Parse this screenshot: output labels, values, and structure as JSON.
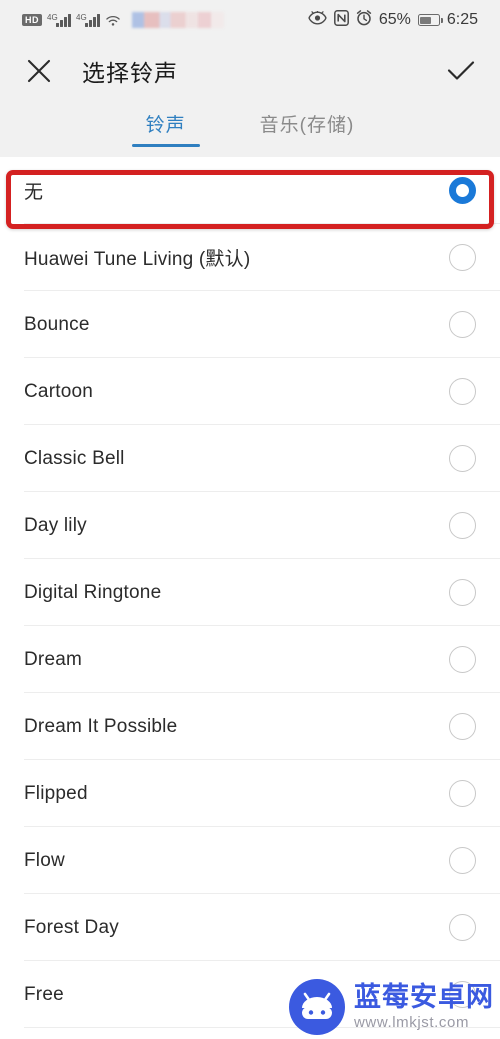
{
  "statusbar": {
    "hd_label": "HD",
    "net1": "4G",
    "net2": "4G",
    "icons": [
      "hd-badge",
      "signal-bars-1",
      "signal-bars-2",
      "wifi-icon",
      "redacted-carrier",
      "eye-icon",
      "nfc-icon",
      "alarm-icon",
      "battery-icon"
    ],
    "battery_percent": "65%",
    "time": "6:25"
  },
  "appbar": {
    "close_icon": "close-icon",
    "title": "选择铃声",
    "confirm_icon": "check-icon"
  },
  "tabs": [
    {
      "label": "铃声",
      "active": true
    },
    {
      "label": "音乐(存储)",
      "active": false
    }
  ],
  "colors": {
    "accent": "#2f7fc0",
    "radio_selected": "#1a79d8",
    "highlight_box": "#d42121",
    "bar_background": "#f1f1f1",
    "watermark_blue": "#3b5ae0"
  },
  "list": {
    "items": [
      {
        "label": "无",
        "selected": true
      },
      {
        "label": "Huawei Tune Living (默认)",
        "selected": false
      },
      {
        "label": "Bounce",
        "selected": false
      },
      {
        "label": "Cartoon",
        "selected": false
      },
      {
        "label": "Classic Bell",
        "selected": false
      },
      {
        "label": "Day lily",
        "selected": false
      },
      {
        "label": "Digital Ringtone",
        "selected": false
      },
      {
        "label": "Dream",
        "selected": false
      },
      {
        "label": "Dream It Possible",
        "selected": false
      },
      {
        "label": "Flipped",
        "selected": false
      },
      {
        "label": "Flow",
        "selected": false
      },
      {
        "label": "Forest Day",
        "selected": false
      },
      {
        "label": "Free",
        "selected": false
      }
    ]
  },
  "watermark": {
    "brand": "蓝莓安卓网",
    "url": "www.lmkjst.com"
  }
}
